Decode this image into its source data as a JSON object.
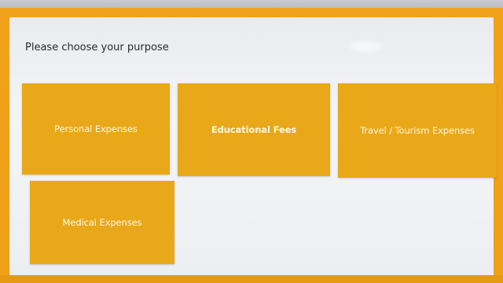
{
  "header": {
    "prompt": "Please choose your purpose"
  },
  "purposes": [
    {
      "label": "Personal Expenses"
    },
    {
      "label": "Educational Fees"
    },
    {
      "label": "Travel / Tourism Expenses"
    },
    {
      "label": "Medical Expenses"
    }
  ],
  "colors": {
    "frame": "#f1a21a",
    "tile": "#e8a819",
    "panel": "#f0f1f3",
    "tile_text": "#fff7e4"
  }
}
